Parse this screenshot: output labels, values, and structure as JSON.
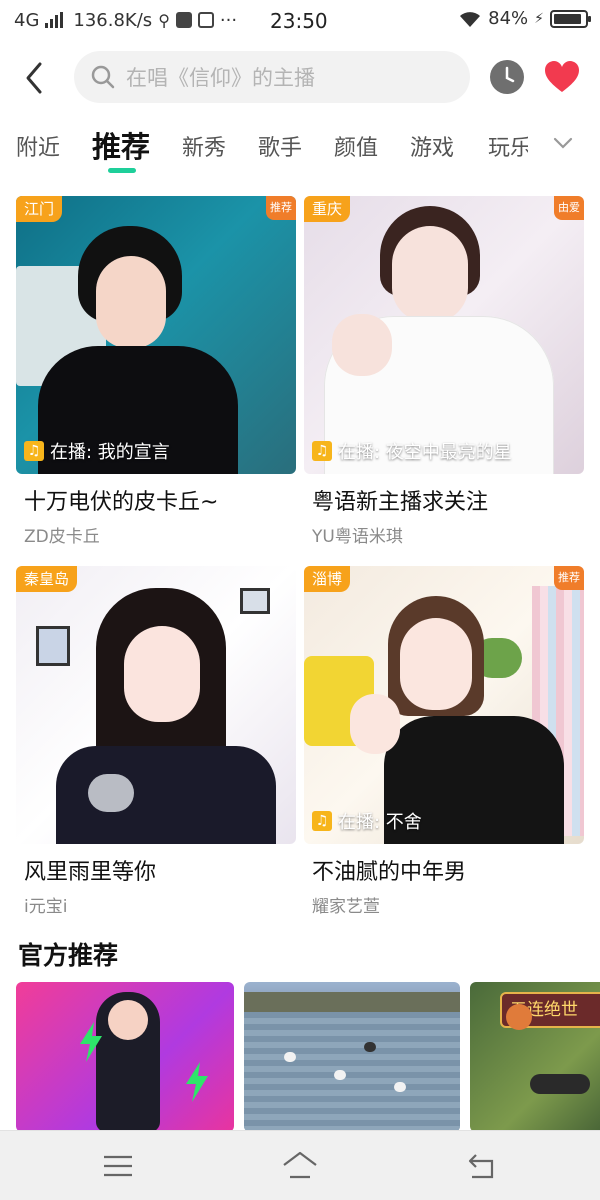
{
  "status_bar": {
    "network": "4G",
    "speed": "136.8K/s",
    "time": "23:50",
    "battery": "84%"
  },
  "search": {
    "placeholder": "在唱《信仰》的主播"
  },
  "tabs": [
    {
      "label": "附近"
    },
    {
      "label": "推荐"
    },
    {
      "label": "新秀"
    },
    {
      "label": "歌手"
    },
    {
      "label": "颜值"
    },
    {
      "label": "游戏"
    },
    {
      "label": "玩乐"
    }
  ],
  "cards": [
    {
      "city": "江门",
      "badge": "推荐",
      "playing": "在播: 我的宣言",
      "title": "十万电伏的皮卡丘~",
      "streamer": "ZD皮卡丘"
    },
    {
      "city": "重庆",
      "badge": "由爱",
      "playing": "在播: 夜空中最亮的星",
      "title": "粤语新主播求关注",
      "streamer": "YU粤语米琪"
    },
    {
      "city": "秦皇岛",
      "badge": "",
      "playing": "",
      "title": "风里雨里等你",
      "streamer": "i元宝i"
    },
    {
      "city": "淄博",
      "badge": "推荐",
      "playing": "在播: 不舍",
      "title": "不油腻的中年男",
      "streamer": "耀家艺萱"
    }
  ],
  "official": {
    "title": "官方推荐",
    "banner_text": "五连绝世"
  },
  "colors": {
    "accent": "#1ecf9a",
    "city_tag": "#f7a21b",
    "heart": "#f23a4f"
  },
  "icons": [
    "back-arrow-icon",
    "search-icon",
    "clock-icon",
    "heart-icon",
    "chevron-down-icon",
    "music-note-icon",
    "menu-icon",
    "home-icon",
    "back-icon"
  ]
}
